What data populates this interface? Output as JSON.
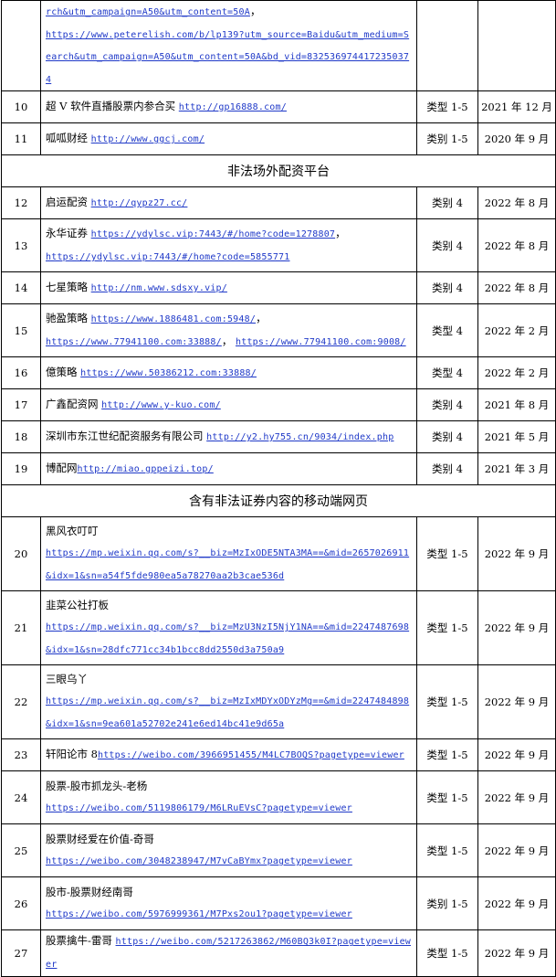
{
  "rows": [
    {
      "type": "entry",
      "h": 81,
      "no": "",
      "parts": [
        {
          "k": "url",
          "t": "rch&utm_campaign=A50&utm_content=50A"
        },
        {
          "k": "text",
          "t": "，"
        },
        {
          "k": "br"
        },
        {
          "k": "url",
          "t": "https://www.peterelish.com/b/lp139?utm_source=Baidu&utm_medium=Search&utm_campaign=A50&utm_content=50A&bd_vid=8325369744172350374"
        }
      ],
      "category": "",
      "date": ""
    },
    {
      "type": "entry",
      "h": 35,
      "no": "10",
      "parts": [
        {
          "k": "text",
          "t": "超 V 软件直播股票内参合买 "
        },
        {
          "k": "url",
          "t": "http://gp16888.com/"
        }
      ],
      "category": "类型 1-5",
      "date": "2021 年 12 月"
    },
    {
      "type": "entry",
      "h": 35,
      "no": "11",
      "parts": [
        {
          "k": "text",
          "t": "呱呱财经 "
        },
        {
          "k": "url",
          "t": "http://www.ggcj.com/"
        }
      ],
      "category": "类别 1-5",
      "date": "2020 年 9 月"
    },
    {
      "type": "section",
      "h": 35,
      "title": "非法场外配资平台"
    },
    {
      "type": "entry",
      "h": 35,
      "no": "12",
      "parts": [
        {
          "k": "text",
          "t": "启运配资 "
        },
        {
          "k": "url",
          "t": "http://qypz27.cc/"
        }
      ],
      "category": "类别 4",
      "date": "2022 年 8 月"
    },
    {
      "type": "entry",
      "h": 58,
      "no": "13",
      "parts": [
        {
          "k": "text",
          "t": "永华证券 "
        },
        {
          "k": "url",
          "t": "https://ydylsc.vip:7443/#/home?code=1278807"
        },
        {
          "k": "text",
          "t": "，"
        },
        {
          "k": "br"
        },
        {
          "k": "url",
          "t": "https://ydylsc.vip:7443/#/home?code=5855771"
        }
      ],
      "category": "类别 4",
      "date": "2022 年 8 月"
    },
    {
      "type": "entry",
      "h": 35,
      "no": "14",
      "parts": [
        {
          "k": "text",
          "t": "七星策略 "
        },
        {
          "k": "url",
          "t": "http://nm.www.sdsxy.vip/"
        }
      ],
      "category": "类别 4",
      "date": "2022 年 8 月"
    },
    {
      "type": "entry",
      "h": 58,
      "no": "15",
      "parts": [
        {
          "k": "text",
          "t": "驰盈策略 "
        },
        {
          "k": "url",
          "t": "https://www.1886481.com:5948/"
        },
        {
          "k": "text",
          "t": "，"
        },
        {
          "k": "br"
        },
        {
          "k": "url",
          "t": "https://www.77941100.com:33888/"
        },
        {
          "k": "text",
          "t": "， "
        },
        {
          "k": "url",
          "t": "https://www.77941100.com:9008/"
        }
      ],
      "category": "类型 4",
      "date": "2022 年 2 月"
    },
    {
      "type": "entry",
      "h": 35,
      "no": "16",
      "parts": [
        {
          "k": "text",
          "t": "億策略 "
        },
        {
          "k": "url",
          "t": "https://www.50386212.com:33888/"
        }
      ],
      "category": "类型 4",
      "date": "2022 年 2 月"
    },
    {
      "type": "entry",
      "h": 35,
      "no": "17",
      "parts": [
        {
          "k": "text",
          "t": "广鑫配资网 "
        },
        {
          "k": "url",
          "t": "http://www.y-kuo.com/"
        }
      ],
      "category": "类别 4",
      "date": "2021 年 8 月"
    },
    {
      "type": "entry",
      "h": 35,
      "no": "18",
      "parts": [
        {
          "k": "text",
          "t": "深圳市东江世纪配资服务有限公司 "
        },
        {
          "k": "url",
          "t": "http://y2.hy755.cn/9034/index.php"
        }
      ],
      "category": "类别 4",
      "date": "2021 年 5 月"
    },
    {
      "type": "entry",
      "h": 35,
      "no": "19",
      "parts": [
        {
          "k": "text",
          "t": "博配网"
        },
        {
          "k": "url",
          "t": "http://miao.gppeizi.top/"
        }
      ],
      "category": "类别 4",
      "date": "2021 年 3 月"
    },
    {
      "type": "section",
      "h": 35,
      "title": "含有非法证券内容的移动端网页"
    },
    {
      "type": "entry",
      "h": 81,
      "no": "20",
      "parts": [
        {
          "k": "text",
          "t": "黑风衣叮叮"
        },
        {
          "k": "br"
        },
        {
          "k": "url",
          "t": "https://mp.weixin.qq.com/s?__biz=MzIxODE5NTA3MA==&mid=2657026911&idx=1&sn=a54f5fde980ea5a78270aa2b3cae536d"
        }
      ],
      "category": "类型 1-5",
      "date": "2022 年 9 月"
    },
    {
      "type": "entry",
      "h": 81,
      "no": "21",
      "parts": [
        {
          "k": "text",
          "t": "韭菜公社打板"
        },
        {
          "k": "br"
        },
        {
          "k": "url",
          "t": "https://mp.weixin.qq.com/s?__biz=MzU3NzI5NjY1NA==&mid=2247487698&idx=1&sn=28dfc771cc34b1bcc8dd2550d3a750a9"
        }
      ],
      "category": "类型 1-5",
      "date": "2022 年 9 月"
    },
    {
      "type": "entry",
      "h": 81,
      "no": "22",
      "parts": [
        {
          "k": "text",
          "t": "三眼乌丫"
        },
        {
          "k": "br"
        },
        {
          "k": "url",
          "t": "https://mp.weixin.qq.com/s?__biz=MzIxMDYxODYzMg==&mid=2247484898&idx=1&sn=9ea601a52702e241e6ed14bc41e9d65a"
        }
      ],
      "category": "类型 1-5",
      "date": "2022 年 9 月"
    },
    {
      "type": "entry",
      "h": 35,
      "no": "23",
      "parts": [
        {
          "k": "text",
          "t": "轩阳论市 8"
        },
        {
          "k": "url",
          "t": "https://weibo.com/3966951455/M4LC7BOQS?pagetype=viewer"
        }
      ],
      "category": "类型 1-5",
      "date": "2022 年 9 月"
    },
    {
      "type": "entry",
      "h": 58,
      "no": "24",
      "parts": [
        {
          "k": "text",
          "t": "股票-股市抓龙头-老杨"
        },
        {
          "k": "br"
        },
        {
          "k": "url",
          "t": "https://weibo.com/5119806179/M6LRuEVsC?pagetype=viewer"
        }
      ],
      "category": "类型 1-5",
      "date": "2022 年 9 月"
    },
    {
      "type": "entry",
      "h": 58,
      "no": "25",
      "parts": [
        {
          "k": "text",
          "t": "股票财经爱在价值-奇哥"
        },
        {
          "k": "br"
        },
        {
          "k": "url",
          "t": "https://weibo.com/3048238947/M7vCaBYmx?pagetype=viewer"
        }
      ],
      "category": "类型 1-5",
      "date": "2022 年 9 月"
    },
    {
      "type": "entry",
      "h": 58,
      "no": "26",
      "parts": [
        {
          "k": "text",
          "t": "股市-股票财经南哥"
        },
        {
          "k": "br"
        },
        {
          "k": "url",
          "t": "https://weibo.com/5976999361/M7Pxs2ou1?pagetype=viewer"
        }
      ],
      "category": "类别 1-5",
      "date": "2022 年 9 月"
    },
    {
      "type": "entry",
      "h": 35,
      "no": "27",
      "parts": [
        {
          "k": "text",
          "t": "股票擒牛-雷哥 "
        },
        {
          "k": "url",
          "t": "https://weibo.com/5217263862/M60BQ3k0I?pagetype=viewer"
        }
      ],
      "category": "类型 1-5",
      "date": "2022 年 9 月"
    }
  ]
}
